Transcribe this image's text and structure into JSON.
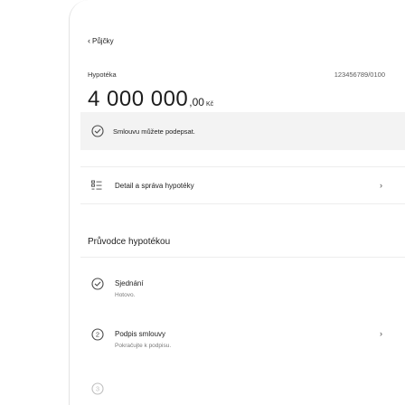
{
  "nav": {
    "back_label": "Půjčky"
  },
  "loan": {
    "label": "Hypotéka",
    "number": "123456789/0100",
    "amount_main": "4 000 000",
    "amount_decimals": ",00",
    "currency": "Kč"
  },
  "notice": {
    "text": "Smlouvu můžete podepsat.",
    "icon": "check-circle-icon"
  },
  "detail": {
    "label": "Detail a správa hypotéky",
    "icon": "list-icon"
  },
  "guide": {
    "title": "Průvodce hypotékou",
    "steps": [
      {
        "title": "Sjednání",
        "subtitle": "Hotovo.",
        "icon": "check-circle-icon",
        "state": "done"
      },
      {
        "title": "Podpis smlouvy",
        "subtitle": "Pokračujte k podpisu.",
        "icon": "number-2-circle-icon",
        "state": "active"
      },
      {
        "title": "",
        "subtitle": "",
        "icon": "number-3-circle-icon",
        "state": "pending"
      }
    ]
  },
  "colors": {
    "accent": "#4a4a4a",
    "notice_bg": "#f3f3f3",
    "divider": "#ededed"
  }
}
